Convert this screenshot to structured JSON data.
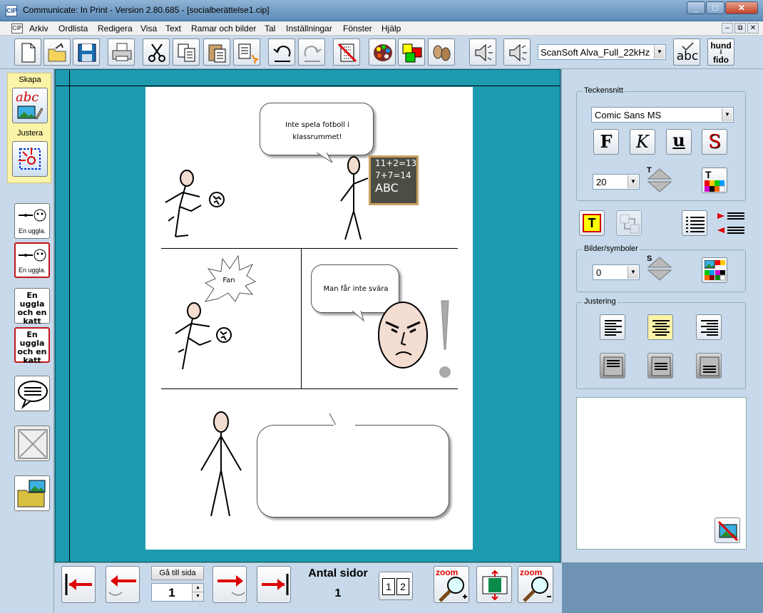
{
  "window": {
    "title": "Communicate: In Print - Version 2.80.685 - [socialberättelse1.cip]",
    "app_icon": "CIP",
    "minimize": "_",
    "maximize": "□",
    "close": "✕"
  },
  "menu": {
    "doc_icon": "CIP",
    "items": [
      "Arkiv",
      "Ordlista",
      "Redigera",
      "Visa",
      "Text",
      "Ramar och bilder",
      "Tal",
      "Inställningar",
      "Fönster",
      "Hjälp"
    ],
    "mdi": [
      "–",
      "⧉",
      "✕"
    ]
  },
  "toolbar": {
    "voice": "ScanSoft Alva_Full_22kHz",
    "spell_label": "abc",
    "hund": "hund",
    "fido": "fido"
  },
  "left": {
    "skapa": "Skapa",
    "justera": "Justera",
    "owl1": "En uggla.",
    "owl2": "En uggla.",
    "txt1": "En uggla och en katt",
    "txt2": "En uggla och en katt",
    "abc": "abc"
  },
  "page": {
    "bubble1": "Inte spela fotboll i klassrummet!",
    "board": [
      "11+2=13",
      "7+7=14",
      "ABC"
    ],
    "bubble2": "Fan",
    "bubble3": "Man får inte svära",
    "bubble4": ""
  },
  "right": {
    "font_group": "Teckensnitt",
    "font": "Comic Sans MS",
    "bold": "F",
    "italic": "K",
    "underline": "u",
    "strike": "S",
    "font_size": "20",
    "t_label": "T",
    "images_group": "Bilder/symboler",
    "image_size": "0",
    "s_label": "S",
    "align_group": "Justering"
  },
  "bottom": {
    "goto_label": "Gå till sida",
    "page_value": "1",
    "page_count_label": "Antal sidor",
    "page_count": "1",
    "page1": "1",
    "page2": "2",
    "zoom": "zoom"
  }
}
